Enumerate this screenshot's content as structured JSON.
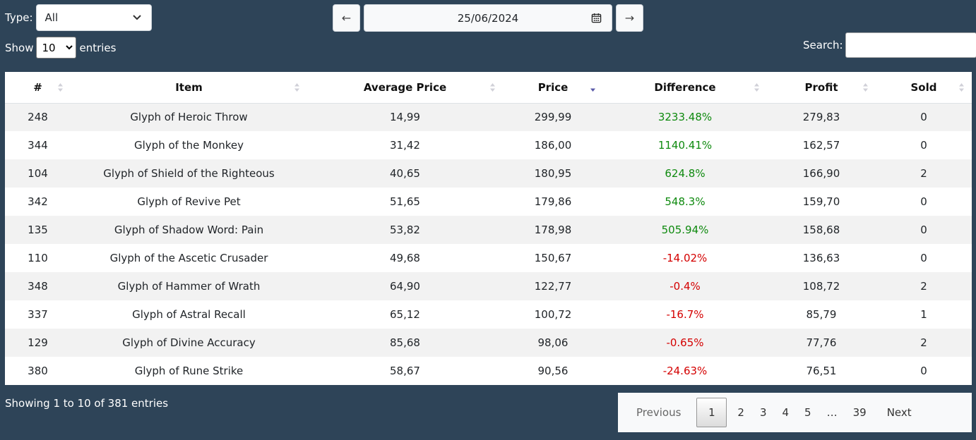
{
  "filters": {
    "type_label": "Type:",
    "type_value": "All",
    "show_label": "Show",
    "show_value": "10",
    "entries_label": "entries",
    "search_label": "Search:",
    "search_value": ""
  },
  "date_nav": {
    "prev_label": "←",
    "date_value": "25/06/2024",
    "next_label": "→"
  },
  "table": {
    "headers": [
      "#",
      "Item",
      "Average Price",
      "Price",
      "Difference",
      "Profit",
      "Sold"
    ],
    "sorted_column": "Price",
    "sort_direction": "descending",
    "rows": [
      {
        "id": "248",
        "item": "Glyph of Heroic Throw",
        "avg": "14,99",
        "price": "299,99",
        "diff": "3233.48%",
        "profit": "279,83",
        "sold": "0"
      },
      {
        "id": "344",
        "item": "Glyph of the Monkey",
        "avg": "31,42",
        "price": "186,00",
        "diff": "1140.41%",
        "profit": "162,57",
        "sold": "0"
      },
      {
        "id": "104",
        "item": "Glyph of Shield of the Righteous",
        "avg": "40,65",
        "price": "180,95",
        "diff": "624.8%",
        "profit": "166,90",
        "sold": "2"
      },
      {
        "id": "342",
        "item": "Glyph of Revive Pet",
        "avg": "51,65",
        "price": "179,86",
        "diff": "548.3%",
        "profit": "159,70",
        "sold": "0"
      },
      {
        "id": "135",
        "item": "Glyph of Shadow Word: Pain",
        "avg": "53,82",
        "price": "178,98",
        "diff": "505.94%",
        "profit": "158,68",
        "sold": "0"
      },
      {
        "id": "110",
        "item": "Glyph of the Ascetic Crusader",
        "avg": "49,68",
        "price": "150,67",
        "diff": "-14.02%",
        "profit": "136,63",
        "sold": "0"
      },
      {
        "id": "348",
        "item": "Glyph of Hammer of Wrath",
        "avg": "64,90",
        "price": "122,77",
        "diff": "-0.4%",
        "profit": "108,72",
        "sold": "2"
      },
      {
        "id": "337",
        "item": "Glyph of Astral Recall",
        "avg": "65,12",
        "price": "100,72",
        "diff": "-16.7%",
        "profit": "85,79",
        "sold": "1"
      },
      {
        "id": "129",
        "item": "Glyph of Divine Accuracy",
        "avg": "85,68",
        "price": "98,06",
        "diff": "-0.65%",
        "profit": "77,76",
        "sold": "2"
      },
      {
        "id": "380",
        "item": "Glyph of Rune Strike",
        "avg": "58,67",
        "price": "90,56",
        "diff": "-24.63%",
        "profit": "76,51",
        "sold": "0"
      }
    ]
  },
  "footer": {
    "info": "Showing 1 to 10 of 381 entries",
    "pagination": {
      "previous": "Previous",
      "pages": [
        "1",
        "2",
        "3",
        "4",
        "5",
        "…",
        "39"
      ],
      "current": "1",
      "next": "Next"
    }
  },
  "colors": {
    "background": "#2e4458",
    "positive": "#0f8a0f",
    "negative": "#d40000",
    "sort_active": "#5a5aa8"
  }
}
